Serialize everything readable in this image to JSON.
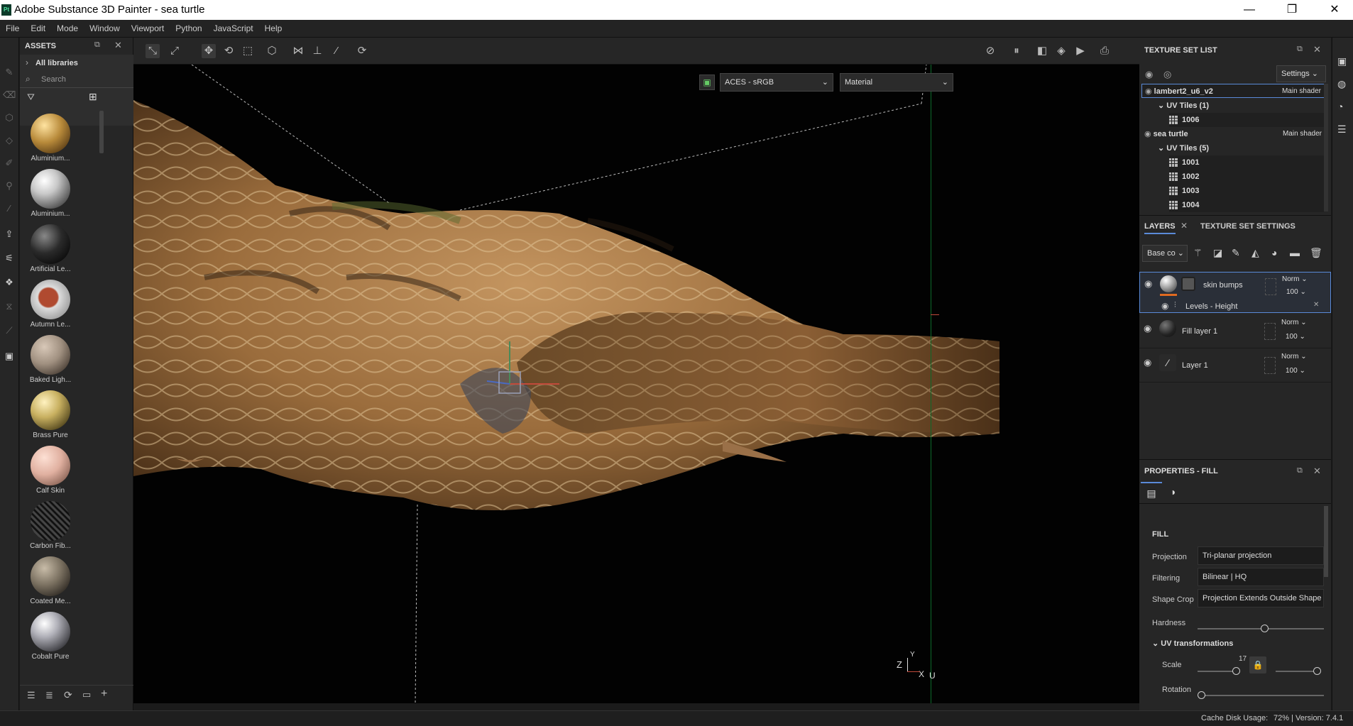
{
  "window": {
    "title": "Adobe Substance 3D Painter - sea turtle",
    "logo": "Pt",
    "minimize": "—",
    "maximize": "❐",
    "close": "✕"
  },
  "menu": [
    "File",
    "Edit",
    "Mode",
    "Window",
    "Viewport",
    "Python",
    "JavaScript",
    "Help"
  ],
  "assets": {
    "header": "ASSETS",
    "libraries": "All libraries",
    "search_placeholder": "Search",
    "items": [
      {
        "label": "Aluminium...",
        "color": "#b88a3a"
      },
      {
        "label": "Aluminium...",
        "color": "#c8c8c8"
      },
      {
        "label": "Artificial Le...",
        "color": "#2a2a2a"
      },
      {
        "label": "Autumn Le...",
        "color": "#b04a30"
      },
      {
        "label": "Baked Ligh...",
        "color": "#a09080"
      },
      {
        "label": "Brass Pure",
        "color": "#c8b060"
      },
      {
        "label": "Calf Skin",
        "color": "#e0b0a0"
      },
      {
        "label": "Carbon Fib...",
        "color": "#2c2c2c"
      },
      {
        "label": "Coated Me...",
        "color": "#7a7060"
      },
      {
        "label": "Cobalt Pure",
        "color": "#b0b0b8"
      }
    ]
  },
  "viewport": {
    "colorspace": "ACES - sRGB",
    "mode": "Material",
    "axis_z": "Z",
    "axis_y": "Y",
    "axis_x": "X",
    "axis_u": "U"
  },
  "texture_set_list": {
    "header": "TEXTURE SET LIST",
    "settings": "Settings",
    "sets": [
      {
        "name": "lambert2_u6_v2",
        "shader": "Main shader",
        "uv_label": "UV Tiles (1)",
        "tiles": [
          "1006"
        ]
      },
      {
        "name": "sea turtle",
        "shader": "Main shader",
        "uv_label": "UV Tiles (5)",
        "tiles": [
          "1001",
          "1002",
          "1003",
          "1004"
        ]
      }
    ]
  },
  "layers": {
    "tab_layers": "LAYERS",
    "tab_settings": "TEXTURE SET SETTINGS",
    "channel": "Base co",
    "items": [
      {
        "name": "skin bumps",
        "blend": "Norm",
        "opacity": "100"
      },
      {
        "name": "Fill layer 1",
        "blend": "Norm",
        "opacity": "100"
      },
      {
        "name": "Layer 1",
        "blend": "Norm",
        "opacity": "100"
      }
    ],
    "effect": "Levels - Height"
  },
  "properties": {
    "header": "PROPERTIES - FILL",
    "section": "FILL",
    "projection_label": "Projection",
    "projection": "Tri-planar projection",
    "filtering_label": "Filtering",
    "filtering": "Bilinear | HQ",
    "shapecrop_label": "Shape Crop",
    "shapecrop": "Projection Extends Outside Shape",
    "hardness_label": "Hardness",
    "uv_section": "UV transformations",
    "scale_label": "Scale",
    "scale_value": "17",
    "rotation_label": "Rotation"
  },
  "status": {
    "cache": "Cache Disk Usage:",
    "usage": "72% | Version: 7.4.1"
  }
}
